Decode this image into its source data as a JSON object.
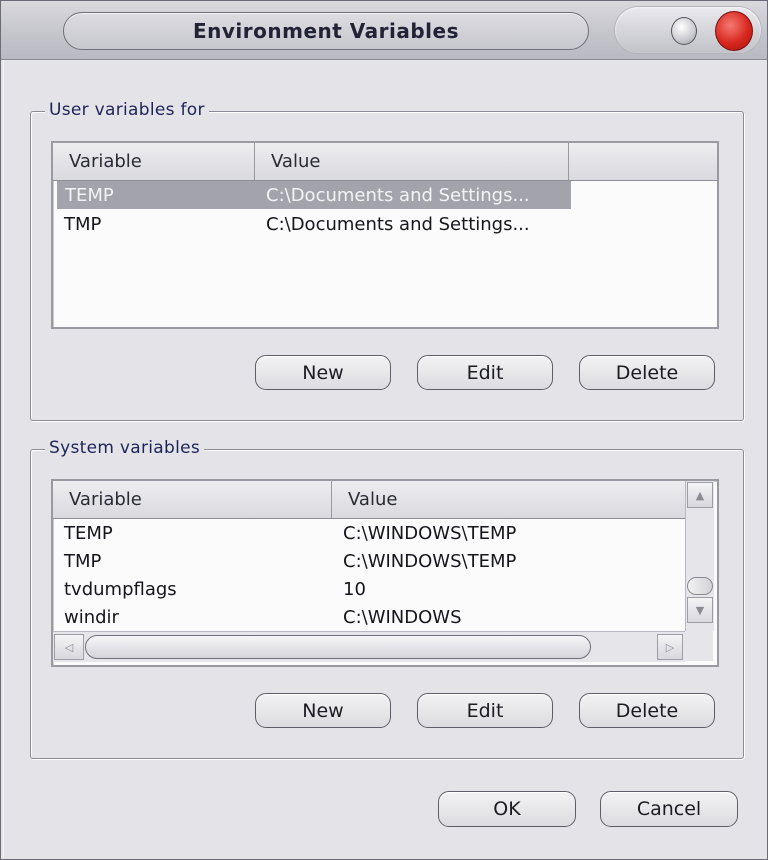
{
  "window": {
    "title": "Environment Variables",
    "controls": {
      "minimize": "minimize-icon",
      "close": "close-icon"
    }
  },
  "user_group": {
    "legend": "User variables for",
    "columns": [
      "Variable",
      "Value"
    ],
    "rows": [
      {
        "variable": "TEMP",
        "value": "C:\\Documents and Settings...",
        "selected": true
      },
      {
        "variable": "TMP",
        "value": "C:\\Documents and Settings...",
        "selected": false
      }
    ],
    "buttons": {
      "new": "New",
      "edit": "Edit",
      "delete": "Delete"
    }
  },
  "system_group": {
    "legend": "System variables",
    "columns": [
      "Variable",
      "Value"
    ],
    "rows": [
      {
        "variable": "TEMP",
        "value": "C:\\WINDOWS\\TEMP"
      },
      {
        "variable": "TMP",
        "value": "C:\\WINDOWS\\TEMP"
      },
      {
        "variable": "tvdumpflags",
        "value": "10"
      },
      {
        "variable": "windir",
        "value": "C:\\WINDOWS"
      }
    ],
    "scrollbar_icons": {
      "up": "▲",
      "down": "▼",
      "left": "◁",
      "right": "▷"
    },
    "buttons": {
      "new": "New",
      "edit": "Edit",
      "delete": "Delete"
    }
  },
  "footer": {
    "ok": "OK",
    "cancel": "Cancel"
  },
  "colors": {
    "title_text": "#222236",
    "legend_text": "#1e2458",
    "selection": "#a3a3ab",
    "close_button": "#d7271e"
  }
}
